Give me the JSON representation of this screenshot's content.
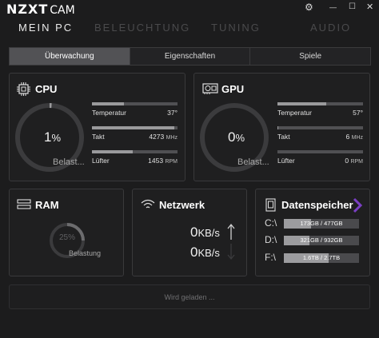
{
  "app": {
    "logo_main": "NZXT",
    "logo_sub": "CAM"
  },
  "window_icons": {
    "settings": "⚙",
    "minimize": "—",
    "maximize": "☐",
    "close": "✕"
  },
  "nav": {
    "items": [
      "MEIN PC",
      "BELEUCHTUNG",
      "TUNING",
      "AUDIO"
    ],
    "active": 0
  },
  "tabs": {
    "items": [
      "Überwachung",
      "Eigenschaften",
      "Spiele"
    ],
    "active": 0
  },
  "cpu": {
    "title": "CPU",
    "load_value": "1",
    "load_unit": "%",
    "load_label": "Belast...",
    "load_fraction": 0.01,
    "stats": [
      {
        "label": "Temperatur",
        "value": "37°",
        "unit": "",
        "fill": 0.37
      },
      {
        "label": "Takt",
        "value": "4273",
        "unit": "MHz",
        "fill": 0.96
      },
      {
        "label": "Lüfter",
        "value": "1453",
        "unit": "RPM",
        "fill": 0.48
      }
    ]
  },
  "gpu": {
    "title": "GPU",
    "load_value": "0",
    "load_unit": "%",
    "load_label": "Belast...",
    "load_fraction": 0.0,
    "stats": [
      {
        "label": "Temperatur",
        "value": "57°",
        "unit": "",
        "fill": 0.57
      },
      {
        "label": "Takt",
        "value": "6",
        "unit": "MHz",
        "fill": 0.01
      },
      {
        "label": "Lüfter",
        "value": "0",
        "unit": "RPM",
        "fill": 0.0
      }
    ]
  },
  "ram": {
    "title": "RAM",
    "load_value": "25%",
    "load_label": "Belastung",
    "load_fraction": 0.25
  },
  "network": {
    "title": "Netzwerk",
    "upload_value": "0",
    "upload_unit": "KB/s",
    "download_value": "0",
    "download_unit": "KB/s"
  },
  "storage": {
    "title": "Datenspeicher",
    "drives": [
      {
        "letter": "C:\\",
        "text": "173GB / 477GB",
        "fill": 0.363
      },
      {
        "letter": "D:\\",
        "text": "321GB / 932GB",
        "fill": 0.344
      },
      {
        "letter": "F:\\",
        "text": "1.6TB / 2.7TB",
        "fill": 0.593
      }
    ]
  },
  "footer": {
    "loading_text": "Wird geladen ..."
  },
  "colors": {
    "background": "#1c1c1d",
    "panel_border": "#39393b",
    "accent": "#7b3fc4",
    "bar_fill": "#9a9a9c",
    "bar_bg": "#505053"
  }
}
